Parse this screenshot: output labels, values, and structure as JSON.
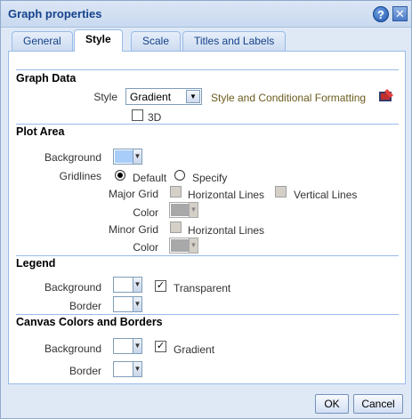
{
  "dialog": {
    "title": "Graph properties",
    "help_glyph": "?",
    "close_glyph": "✕"
  },
  "tabs": [
    {
      "label": "General"
    },
    {
      "label": "Style"
    },
    {
      "label": "Scale"
    },
    {
      "label": "Titles and Labels"
    }
  ],
  "active_tab": "Style",
  "graph_data": {
    "heading": "Graph Data",
    "style_label": "Style",
    "style_value": "Gradient",
    "style_link": "Style and Conditional Formatting",
    "three_d_label": "3D",
    "three_d_checked": false
  },
  "plot_area": {
    "heading": "Plot Area",
    "background_label": "Background",
    "background_color": "#a9cdf9",
    "gridlines_label": "Gridlines",
    "default_label": "Default",
    "specify_label": "Specify",
    "gridlines_mode": "Default",
    "major_grid_label": "Major Grid",
    "horizontal_lines_label": "Horizontal Lines",
    "vertical_lines_label": "Vertical Lines",
    "major_color_label": "Color",
    "major_color": "#a8a8a8",
    "minor_grid_label": "Minor Grid",
    "minor_horizontal_label": "Horizontal Lines",
    "minor_color_label": "Color",
    "minor_color": "#a8a8a8"
  },
  "legend": {
    "heading": "Legend",
    "background_label": "Background",
    "border_label": "Border",
    "transparent_label": "Transparent",
    "transparent_checked": true,
    "check_glyph": "✓"
  },
  "canvas": {
    "heading": "Canvas Colors and Borders",
    "background_label": "Background",
    "border_label": "Border",
    "gradient_label": "Gradient",
    "gradient_checked": true,
    "check_glyph": "✓"
  },
  "dropdown_arrow": "▼",
  "footer": {
    "ok_label": "OK",
    "cancel_label": "Cancel"
  }
}
